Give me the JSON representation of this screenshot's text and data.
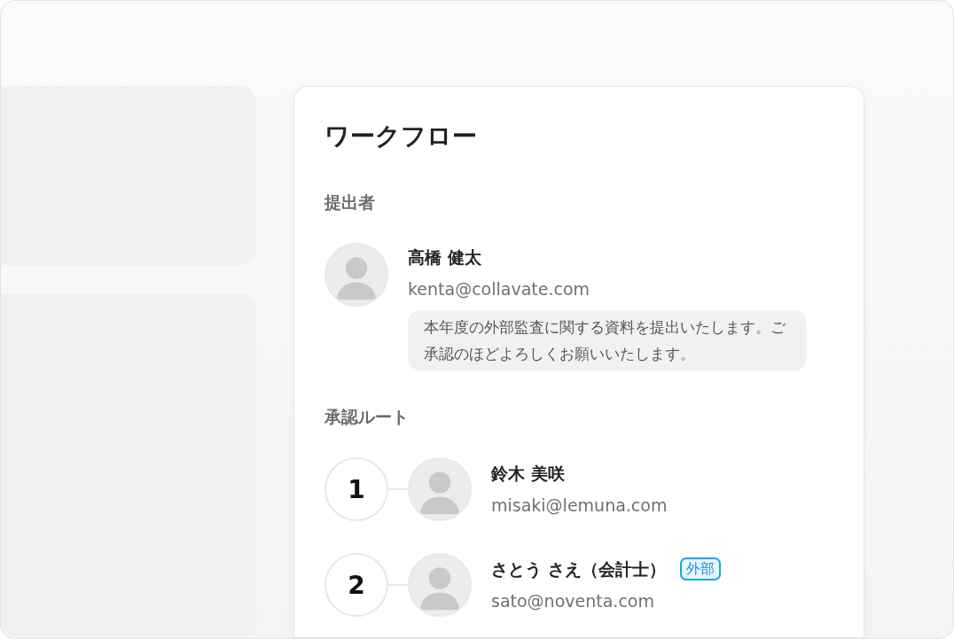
{
  "card": {
    "title": "ワークフロー"
  },
  "submitter": {
    "label": "提出者",
    "name": "高橋 健太",
    "email": "kenta@collavate.com",
    "message": "本年度の外部監査に関する資料を提出いたします。ご承認のほどよろしくお願いいたします。"
  },
  "approval_route": {
    "label": "承認ルート",
    "approvers": [
      {
        "step": "1",
        "name": "鈴木 美咲",
        "email": "misaki@lemuna.com"
      },
      {
        "step": "2",
        "name": "さとう さえ（会計士）",
        "badge": "外部",
        "email": "sato@noventa.com"
      }
    ]
  }
}
